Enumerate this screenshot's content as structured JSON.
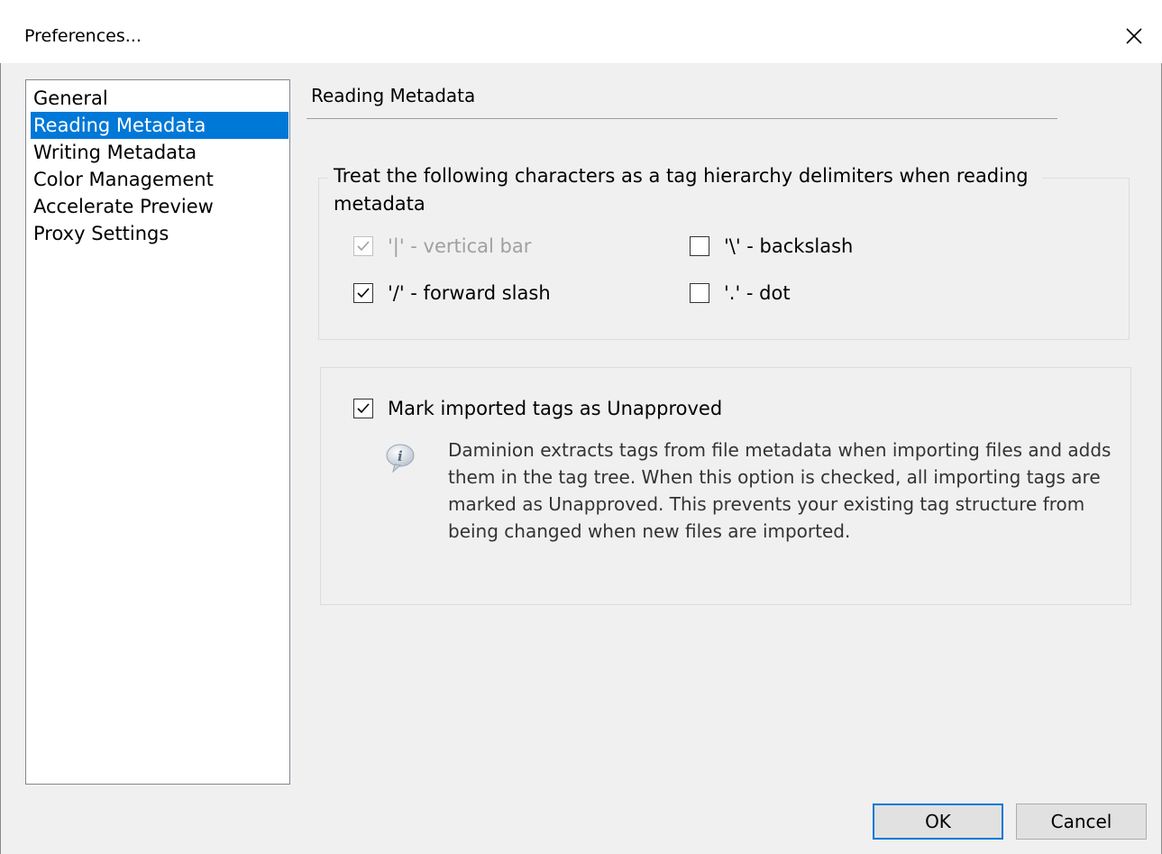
{
  "window": {
    "title": "Preferences...",
    "close_icon": "close-icon"
  },
  "sidebar": {
    "items": [
      {
        "label": "General",
        "selected": false
      },
      {
        "label": "Reading Metadata",
        "selected": true
      },
      {
        "label": "Writing Metadata",
        "selected": false
      },
      {
        "label": "Color Management",
        "selected": false
      },
      {
        "label": "Accelerate Preview",
        "selected": false
      },
      {
        "label": "Proxy Settings",
        "selected": false
      }
    ]
  },
  "main": {
    "section_title": "Reading Metadata",
    "delimiters": {
      "group_title": "Treat the following characters as a tag hierarchy delimiters when reading metadata",
      "options": [
        {
          "label": "'|' - vertical bar",
          "checked": true,
          "disabled": true
        },
        {
          "label": "'\\' - backslash",
          "checked": false,
          "disabled": false
        },
        {
          "label": "'/' - forward slash",
          "checked": true,
          "disabled": false
        },
        {
          "label": "'.' - dot",
          "checked": false,
          "disabled": false
        }
      ]
    },
    "unapproved": {
      "label": "Mark imported tags as Unapproved",
      "checked": true,
      "info_icon": "info-icon",
      "info_text": "Daminion extracts tags from file metadata when importing files and adds them in the tag tree. When this option is checked, all importing tags are marked as Unapproved. This prevents your existing tag structure from being changed when new files are imported."
    }
  },
  "footer": {
    "ok_label": "OK",
    "cancel_label": "Cancel"
  },
  "colors": {
    "selection": "#0078d7",
    "background": "#f0f0f0"
  }
}
